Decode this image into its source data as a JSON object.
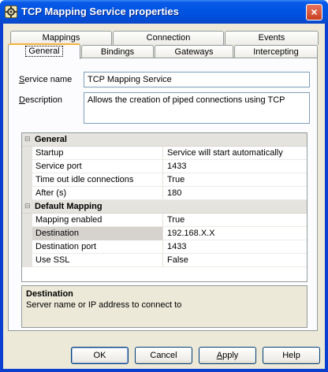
{
  "window": {
    "title": "TCP Mapping Service properties",
    "close_glyph": "×"
  },
  "tabs": {
    "row_top": [
      "Mappings",
      "Connection",
      "Events"
    ],
    "row_bottom": [
      "General",
      "Bindings",
      "Gateways",
      "Intercepting"
    ],
    "active": "General"
  },
  "general": {
    "service_name_label_prefix": "S",
    "service_name_label_rest": "ervice name",
    "service_name_value": "TCP Mapping Service",
    "description_label_prefix": "D",
    "description_label_rest": "escription",
    "description_value": "Allows the creation of piped connections using TCP"
  },
  "properties": {
    "categories": [
      {
        "name": "General",
        "rows": [
          {
            "key": "Startup",
            "value": "Service will start automatically"
          },
          {
            "key": "Service port",
            "value": "1433"
          },
          {
            "key": "Time out idle connections",
            "value": "True"
          },
          {
            "key": "After (s)",
            "value": "180"
          }
        ]
      },
      {
        "name": "Default Mapping",
        "rows": [
          {
            "key": "Mapping enabled",
            "value": "True"
          },
          {
            "key": "Destination",
            "value": "192.168.X.X",
            "selected": true
          },
          {
            "key": "Destination port",
            "value": "1433"
          },
          {
            "key": "Use SSL",
            "value": "False"
          }
        ]
      }
    ],
    "collapse_glyph": "⊟"
  },
  "description_panel": {
    "title": "Destination",
    "text": "Server name or IP address to connect to"
  },
  "buttons": {
    "ok": "OK",
    "cancel": "Cancel",
    "apply_prefix": "A",
    "apply_rest": "pply",
    "help": "Help"
  },
  "colors": {
    "titlebar": "#0053e1",
    "dialog": "#ece9d8",
    "tab_accent": "#f4b23c"
  }
}
